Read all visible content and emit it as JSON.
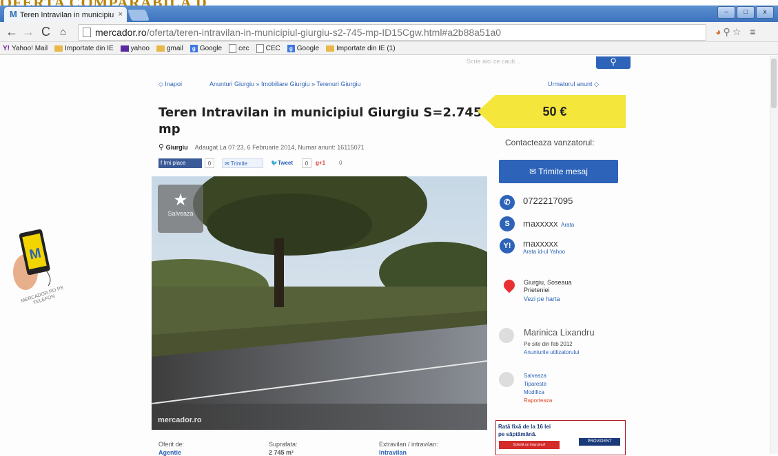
{
  "doc_heading": "OFERTA COMPARABILA D",
  "browser": {
    "tab_title": "Teren Intravilan in municipiu",
    "tab_close": "×",
    "url_domain": "mercador.ro",
    "url_path": "/oferta/teren-intravilan-in-municipiul-giurgiu-s2-745-mp-ID15Cgw.html#a2b88a51a0",
    "bookmarks": [
      "Yahoo! Mail",
      "Importate din IE",
      "yahoo",
      "gmail",
      "Google",
      "cec",
      "CEC",
      "Google",
      "Importate din IE (1)"
    ]
  },
  "site": {
    "search_placeholder": "Scrie aici ce cauti...",
    "back_label": "Inapoi",
    "breadcrumb": "Anunturi Giurgiu » Imobiliare Giurgiu » Terenuri Giurgiu",
    "next_label": "Urmatorul anunt"
  },
  "listing": {
    "title": "Teren Intravilan in municipiul Giurgiu S=2.745 mp",
    "price": "50 €",
    "location": "Giurgiu",
    "meta": "Adaugat La 07:23, 6 Februarie 2014, Numar anunt: 16115071",
    "share": {
      "fb_label": "Imi place",
      "fb_count": "0",
      "mail_label": "Trimite",
      "tweet_label": "Tweet",
      "tweet_count": "0",
      "gplus_label": "+1",
      "gplus_count": "0"
    },
    "save_label": "Salveaza",
    "watermark": "mercador.ro",
    "specs": [
      {
        "label": "Oferit de:",
        "value": "Agentie"
      },
      {
        "label": "Suprafata:",
        "value": "2 745 m²"
      },
      {
        "label": "Extravilan / intravilan:",
        "value": "Intravilan"
      }
    ]
  },
  "contact": {
    "heading": "Contacteaza vanzatorul:",
    "send_button": "Trimite mesaj",
    "phone": "0722217095",
    "skype_user": "maxxxxx",
    "skype_link": "Arata",
    "yahoo_user": "maxxxxx",
    "yahoo_link": "Arata id-ul Yahoo",
    "address_line1": "Giurgiu, Soseaua",
    "address_line2": "Prieteniei",
    "map_link": "Vezi pe harta",
    "seller_name": "Marinica Lixandru",
    "seller_since": "Pe site din feb 2012",
    "seller_ads_link": "Anunturile utilizatorului",
    "actions": [
      "Salveaza",
      "Tipareste",
      "Modifica",
      "Raporteaza"
    ]
  },
  "ad": {
    "line1": "Rată fixă de la 16 lei",
    "line2": "pe săptămână.",
    "button": "Solicită un împrumut!",
    "brand": "PROVIDENT"
  },
  "promo": {
    "text": "MERCADOR.RO PE TELEFON"
  },
  "colors": {
    "accent": "#2d63b8",
    "price_bg": "#f5e63c",
    "danger": "#e83030"
  }
}
